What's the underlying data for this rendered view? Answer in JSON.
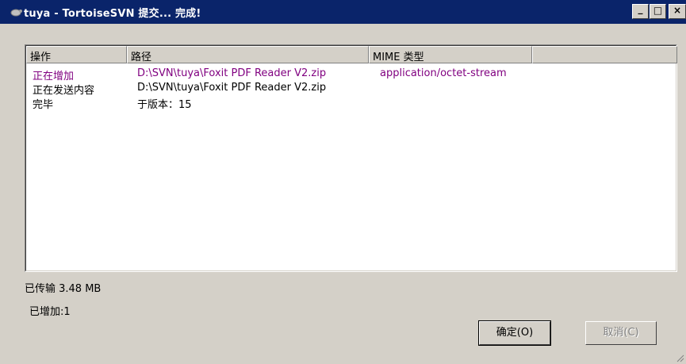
{
  "window": {
    "title": "tuya - TortoiseSVN 提交... 完成!",
    "buttons": {
      "minimize": "_",
      "maximize": "□",
      "close": "×"
    }
  },
  "list": {
    "columns": [
      "操作",
      "路径",
      "MIME 类型",
      ""
    ],
    "rows": [
      {
        "action": "正在增加",
        "path": "D:\\SVN\\tuya\\Foxit PDF Reader V2.zip",
        "mime": "application/octet-stream",
        "color": "#800080"
      },
      {
        "action": "正在发送内容",
        "path": "D:\\SVN\\tuya\\Foxit PDF Reader V2.zip",
        "mime": "",
        "color": "#000000"
      },
      {
        "action": "完毕",
        "path": "于版本：15",
        "mime": "",
        "color": "#000000"
      }
    ]
  },
  "status": {
    "transferred": "已传输 3.48 MB",
    "added": "已增加:1"
  },
  "buttons": {
    "ok": "确定(O)",
    "cancel": "取消(C)"
  }
}
